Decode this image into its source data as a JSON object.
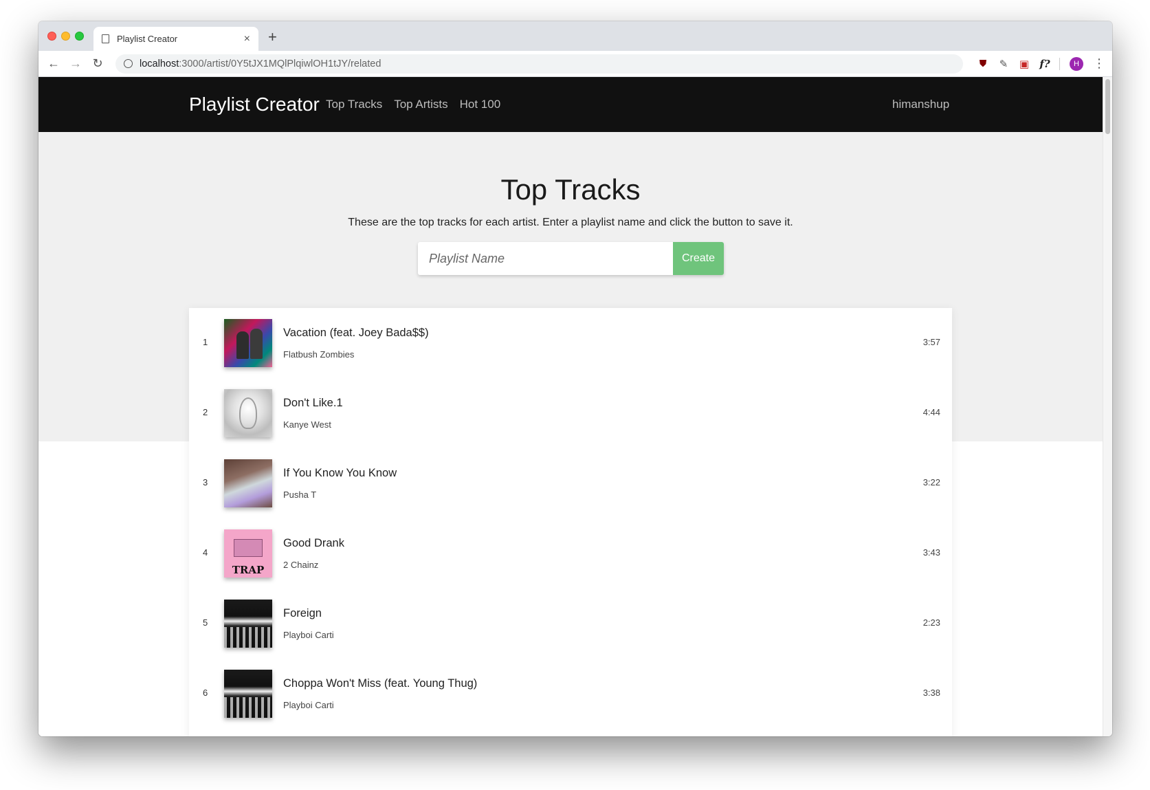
{
  "browser": {
    "tab_title": "Playlist Creator",
    "url_host": "localhost",
    "url_path": ":3000/artist/0Y5tJX1MQlPlqiwlOH1tJY/related",
    "avatar_initial": "H"
  },
  "navbar": {
    "brand": "Playlist Creator",
    "links": [
      "Top Tracks",
      "Top Artists",
      "Hot 100"
    ],
    "user": "himanshup"
  },
  "hero": {
    "title": "Top Tracks",
    "subtitle": "These are the top tracks for each artist. Enter a playlist name and click the button to save it.",
    "input_placeholder": "Playlist Name",
    "create_label": "Create"
  },
  "colors": {
    "navbar_bg": "#111111",
    "hero_bg": "#f0f0f0",
    "create_button": "#6fc47c"
  },
  "tracks": [
    {
      "num": "1",
      "title": "Vacation (feat. Joey Bada$$)",
      "artist": "Flatbush Zombies",
      "duration": "3:57"
    },
    {
      "num": "2",
      "title": "Don't Like.1",
      "artist": "Kanye West",
      "duration": "4:44"
    },
    {
      "num": "3",
      "title": "If You Know You Know",
      "artist": "Pusha T",
      "duration": "3:22"
    },
    {
      "num": "4",
      "title": "Good Drank",
      "artist": "2 Chainz",
      "duration": "3:43",
      "album_text": "TRAP"
    },
    {
      "num": "5",
      "title": "Foreign",
      "artist": "Playboi Carti",
      "duration": "2:23"
    },
    {
      "num": "6",
      "title": "Choppa Won't Miss (feat. Young Thug)",
      "artist": "Playboi Carti",
      "duration": "3:38"
    }
  ]
}
